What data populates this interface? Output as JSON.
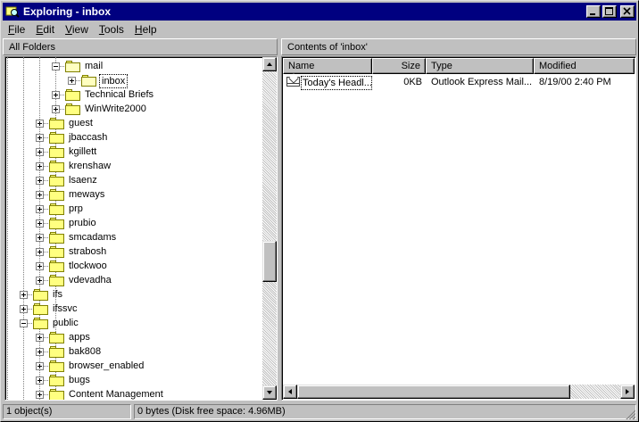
{
  "window": {
    "title": "Exploring - inbox"
  },
  "menu": [
    {
      "label": "File",
      "key": "F",
      "rest": "ile"
    },
    {
      "label": "Edit",
      "key": "E",
      "rest": "dit"
    },
    {
      "label": "View",
      "key": "V",
      "rest": "iew"
    },
    {
      "label": "Tools",
      "key": "T",
      "rest": "ools"
    },
    {
      "label": "Help",
      "key": "H",
      "rest": "elp"
    }
  ],
  "left_header": "All Folders",
  "right_header": "Contents of 'inbox'",
  "tree": {
    "items": [
      {
        "label": "mail",
        "level": 4,
        "expander": "minus",
        "open": true
      },
      {
        "label": "inbox",
        "level": 5,
        "expander": "plus",
        "open": true,
        "selected": true
      },
      {
        "label": "Technical Briefs",
        "level": 4,
        "expander": "plus"
      },
      {
        "label": "WinWrite2000",
        "level": 4,
        "expander": "plus"
      },
      {
        "label": "guest",
        "level": 3,
        "expander": "plus"
      },
      {
        "label": "jbaccash",
        "level": 3,
        "expander": "plus"
      },
      {
        "label": "kgillett",
        "level": 3,
        "expander": "plus"
      },
      {
        "label": "krenshaw",
        "level": 3,
        "expander": "plus"
      },
      {
        "label": "lsaenz",
        "level": 3,
        "expander": "plus"
      },
      {
        "label": "meways",
        "level": 3,
        "expander": "plus"
      },
      {
        "label": "prp",
        "level": 3,
        "expander": "plus"
      },
      {
        "label": "prubio",
        "level": 3,
        "expander": "plus"
      },
      {
        "label": "smcadams",
        "level": 3,
        "expander": "plus"
      },
      {
        "label": "strabosh",
        "level": 3,
        "expander": "plus"
      },
      {
        "label": "tlockwoo",
        "level": 3,
        "expander": "plus"
      },
      {
        "label": "vdevadha",
        "level": 3,
        "expander": "plus"
      },
      {
        "label": "ifs",
        "level": 2,
        "expander": "plus"
      },
      {
        "label": "ifssvc",
        "level": 2,
        "expander": "plus"
      },
      {
        "label": "public",
        "level": 2,
        "expander": "minus"
      },
      {
        "label": "apps",
        "level": 3,
        "expander": "plus"
      },
      {
        "label": "bak808",
        "level": 3,
        "expander": "plus"
      },
      {
        "label": "browser_enabled",
        "level": 3,
        "expander": "plus"
      },
      {
        "label": "bugs",
        "level": 3,
        "expander": "plus"
      },
      {
        "label": "Content Management",
        "level": 3,
        "expander": "plus"
      }
    ]
  },
  "columns": [
    "Name",
    "Size",
    "Type",
    "Modified"
  ],
  "files": [
    {
      "name": "Today's Headl...",
      "size": "0KB",
      "type": "Outlook Express Mail...",
      "modified": "8/19/00 2:40 PM",
      "icon": "mail-icon"
    }
  ],
  "status": {
    "objects": "1 object(s)",
    "space": "0 bytes (Disk free space: 4.96MB)"
  },
  "tree_scroll_fraction": 0.62,
  "colors": {
    "titlebar": "#000080",
    "face": "#c0c0c0",
    "folder": "#ffff80"
  }
}
